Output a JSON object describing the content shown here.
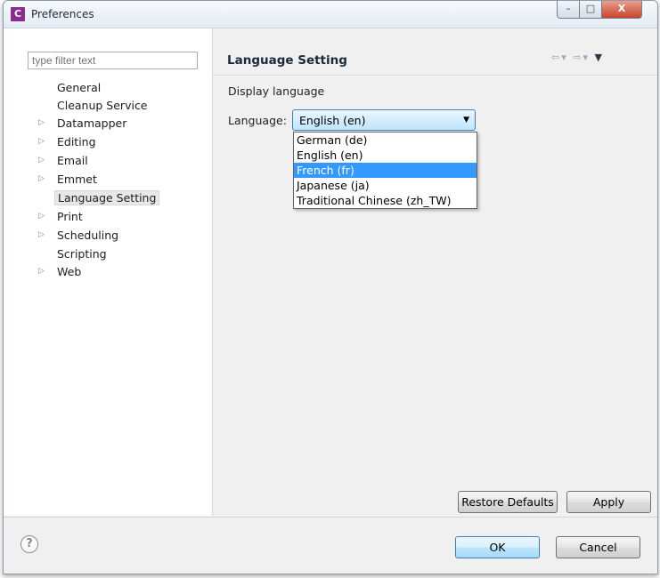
{
  "window": {
    "app_icon_letter": "C",
    "title": "Preferences",
    "controls": {
      "minimize": "–",
      "maximize": "□",
      "close": "X"
    }
  },
  "sidebar": {
    "filter_placeholder": "type filter text",
    "items": [
      {
        "label": "General",
        "expandable": false
      },
      {
        "label": "Cleanup Service",
        "expandable": false
      },
      {
        "label": "Datamapper",
        "expandable": true
      },
      {
        "label": "Editing",
        "expandable": true
      },
      {
        "label": "Email",
        "expandable": true
      },
      {
        "label": "Emmet",
        "expandable": true
      },
      {
        "label": "Language Setting",
        "expandable": false,
        "selected": true
      },
      {
        "label": "Print",
        "expandable": true
      },
      {
        "label": "Scheduling",
        "expandable": true
      },
      {
        "label": "Scripting",
        "expandable": false
      },
      {
        "label": "Web",
        "expandable": true
      }
    ]
  },
  "main": {
    "page_title": "Language Setting",
    "section_label": "Display language",
    "language_label": "Language:",
    "language_selected": "English (en)",
    "language_options": [
      "German (de)",
      "English (en)",
      "French (fr)",
      "Japanese (ja)",
      "Traditional Chinese (zh_TW)"
    ],
    "highlighted_option": "French (fr)",
    "restore_defaults_label": "Restore Defaults",
    "apply_label": "Apply"
  },
  "footer": {
    "help_symbol": "?",
    "ok_label": "OK",
    "cancel_label": "Cancel"
  },
  "colors": {
    "selection_highlight": "#3399ff",
    "close_button": "#c8452e",
    "app_icon": "#8b2c8f"
  }
}
